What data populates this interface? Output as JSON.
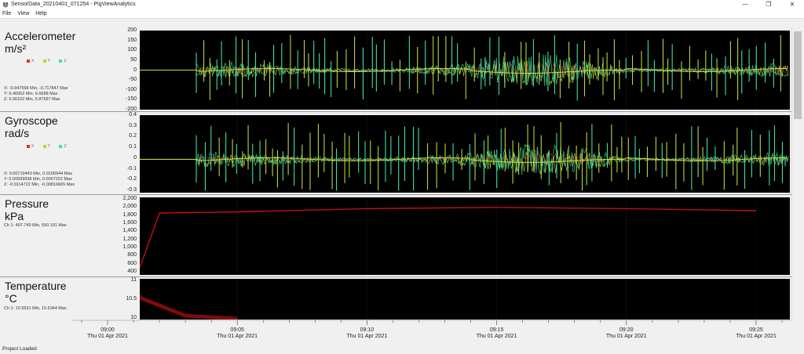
{
  "window": {
    "title": "SensorData_20210401_071254 - PigViewAnalytics",
    "minimize": "—",
    "restore": "❐",
    "close": "✕"
  },
  "menu": [
    "File",
    "View",
    "Help"
  ],
  "colors": {
    "x": "#e03030",
    "y": "#b8d838",
    "z": "#40e0a0",
    "channel": "#c41010"
  },
  "panels": [
    {
      "title": "Accelerometer",
      "unit": "m/s²",
      "legend": [
        "X",
        "Y",
        "Z"
      ],
      "stats": [
        "X: -0.947558 Min, -0.717847 Max",
        "Y: 6.46062 Min, 6.6688 Max",
        "Z: 6.66162 Min, 6.87697 Max"
      ],
      "yticks": [
        "200",
        "150",
        "100",
        "50",
        "0",
        "-50",
        "-100",
        "-150",
        "-200"
      ]
    },
    {
      "title": "Gyroscope",
      "unit": "rad/s",
      "legend": [
        "X",
        "Y",
        "Z"
      ],
      "stats": [
        "X: 0.00719443 Min, 0.0106944 Max",
        "Y: 0.00699998 Min, 0.0097222 Max",
        "Z: -0.0114722 Min, -0.00816665 Max"
      ],
      "yticks": [
        "0.4",
        "0.3",
        "0.2",
        "0.1",
        "0",
        "-0.1",
        "-0.2",
        "-0.3"
      ]
    },
    {
      "title": "Pressure",
      "unit": "kPa",
      "stats": [
        "Ch 1: 497.749 Min, 500.191 Max"
      ],
      "yticks": [
        "2,200",
        "2,000",
        "1,800",
        "1,600",
        "1,400",
        "1,200",
        "1,000",
        "800",
        "600",
        "400"
      ]
    },
    {
      "title": "Temperature",
      "unit": "°C",
      "stats": [
        "Ch 1: 10.5531 Min, 10.6344 Max"
      ],
      "yticks": [
        "11",
        "10.5",
        "10"
      ]
    }
  ],
  "xaxis": {
    "times": [
      "09:00",
      "09:05",
      "09:10",
      "09:15",
      "09:20",
      "09:25"
    ],
    "date": "Thu 01 Apr 2021"
  },
  "status": "Project Loaded",
  "chart_data": [
    {
      "type": "line",
      "title": "Accelerometer",
      "ylabel": "m/s²",
      "ylim": [
        -200,
        200
      ],
      "x": [
        "09:00",
        "09:05",
        "09:10",
        "09:15",
        "09:20",
        "09:25"
      ],
      "series": [
        {
          "name": "X"
        },
        {
          "name": "Y"
        },
        {
          "name": "Z"
        }
      ]
    },
    {
      "type": "line",
      "title": "Gyroscope",
      "ylabel": "rad/s",
      "ylim": [
        -0.3,
        0.4
      ],
      "x": [
        "09:00",
        "09:05",
        "09:10",
        "09:15",
        "09:20",
        "09:25"
      ],
      "series": [
        {
          "name": "X"
        },
        {
          "name": "Y"
        },
        {
          "name": "Z"
        }
      ]
    },
    {
      "type": "line",
      "title": "Pressure",
      "ylabel": "kPa",
      "ylim": [
        400,
        2200
      ],
      "x": [
        "08:57",
        "09:01",
        "09:02",
        "09:05",
        "09:10",
        "09:15",
        "09:20",
        "09:25"
      ],
      "series": [
        {
          "name": "Ch 1",
          "values": [
            500,
            500,
            1850,
            1880,
            1960,
            1990,
            1960,
            1910
          ]
        }
      ]
    },
    {
      "type": "line",
      "title": "Temperature",
      "ylabel": "°C",
      "ylim": [
        10,
        11
      ],
      "x": [
        "08:57",
        "09:01",
        "09:03",
        "09:05"
      ],
      "series": [
        {
          "name": "Ch 1",
          "values": [
            10.62,
            10.55,
            10.08,
            10.0
          ]
        }
      ]
    }
  ]
}
